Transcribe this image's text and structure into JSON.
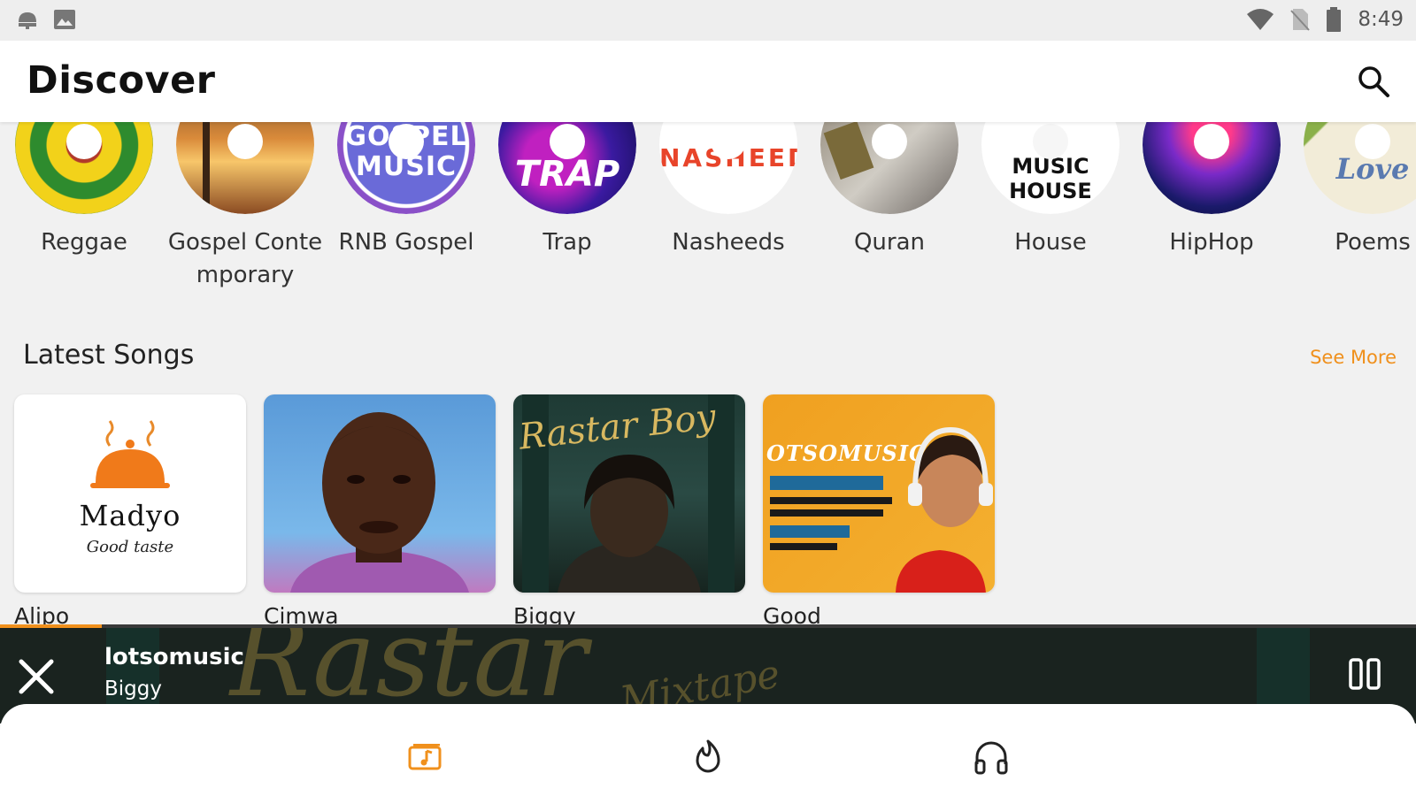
{
  "status_bar": {
    "time": "8:49",
    "icons": [
      "android-notification-icon",
      "image-notification-icon",
      "wifi-icon",
      "no-sim-icon",
      "battery-icon"
    ]
  },
  "app_bar": {
    "title": "Discover",
    "search_icon": "search-icon"
  },
  "categories": [
    {
      "label": "Reggae",
      "art_text": ""
    },
    {
      "label": "Gospel Contemporary",
      "art_text": ""
    },
    {
      "label": "RNB Gospel",
      "art_text": "GOSPEL MUSIC"
    },
    {
      "label": "Trap",
      "art_text": "TRAP"
    },
    {
      "label": "Nasheeds",
      "art_text": "NASHEED"
    },
    {
      "label": "Quran",
      "art_text": ""
    },
    {
      "label": "House",
      "art_text": "MUSIC HOUSE"
    },
    {
      "label": "HipHop",
      "art_text": ""
    },
    {
      "label": "Poems",
      "art_text": "Love"
    }
  ],
  "latest_songs": {
    "title": "Latest Songs",
    "see_more": "See More",
    "items": [
      {
        "title": "Alipo",
        "art_logo": "Madyo",
        "art_sub": "Good taste"
      },
      {
        "title": "Cimwa"
      },
      {
        "title": "Biggy",
        "art_text": "Rastar Boy"
      },
      {
        "title": "Good",
        "art_text": "OTSOMUSIC"
      }
    ]
  },
  "player": {
    "app_name": "lotsomusic",
    "artist": "Biggy",
    "progress": 0.072,
    "bg_text": "Rastar",
    "bg_sub": "Mixtape"
  },
  "bottom_nav": [
    {
      "name": "library-icon",
      "active": true
    },
    {
      "name": "trending-icon",
      "active": false
    },
    {
      "name": "headphones-icon",
      "active": false
    }
  ],
  "colors": {
    "accent": "#f0901c",
    "background": "#f1f1f1",
    "player_bg": "#1c2520"
  }
}
